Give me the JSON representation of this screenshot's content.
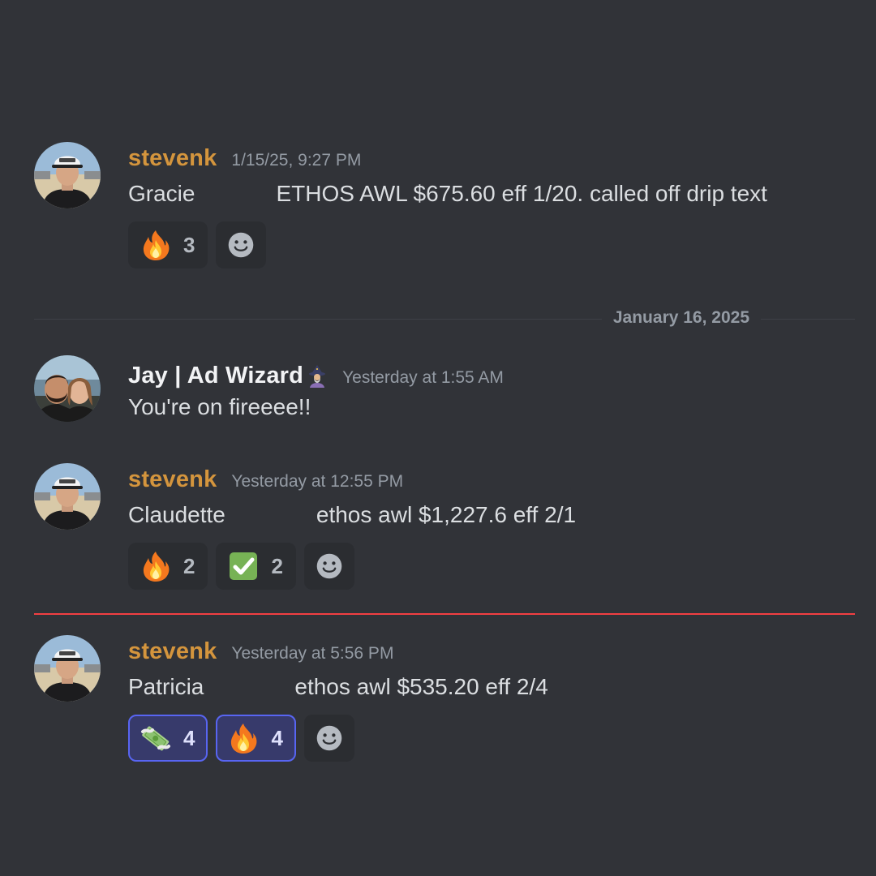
{
  "date_divider": {
    "label": "January 16, 2025"
  },
  "messages": [
    {
      "author": "stevenk",
      "timestamp": "1/15/25, 9:27 PM",
      "text_left": "Gracie",
      "text_right": "ETHOS AWL $675.60 eff 1/20. called off drip text",
      "reactions": [
        {
          "emoji": "fire",
          "count": "3",
          "selected": false
        }
      ]
    },
    {
      "author": "Jay | Ad Wizard",
      "author_emoji": "mage",
      "timestamp": "Yesterday at 1:55 AM",
      "text_left": "You're on fireeee!!"
    },
    {
      "author": "stevenk",
      "timestamp": "Yesterday at 12:55 PM",
      "text_left": "Claudette",
      "text_right": "ethos awl $1,227.6 eff 2/1",
      "reactions": [
        {
          "emoji": "fire",
          "count": "2",
          "selected": false
        },
        {
          "emoji": "white-check-mark",
          "count": "2",
          "selected": false
        }
      ]
    },
    {
      "author": "stevenk",
      "timestamp": "Yesterday at 5:56 PM",
      "text_left": "Patricia",
      "text_right": "ethos awl $535.20 eff 2/4",
      "reactions": [
        {
          "emoji": "money-with-wings",
          "count": "4",
          "selected": true
        },
        {
          "emoji": "fire",
          "count": "4",
          "selected": true
        }
      ]
    }
  ],
  "colors": {
    "background": "#313338",
    "author_stevenk": "#d4953d",
    "new_messages_line": "#f23f42",
    "selected_reaction_border": "#5865f2"
  }
}
